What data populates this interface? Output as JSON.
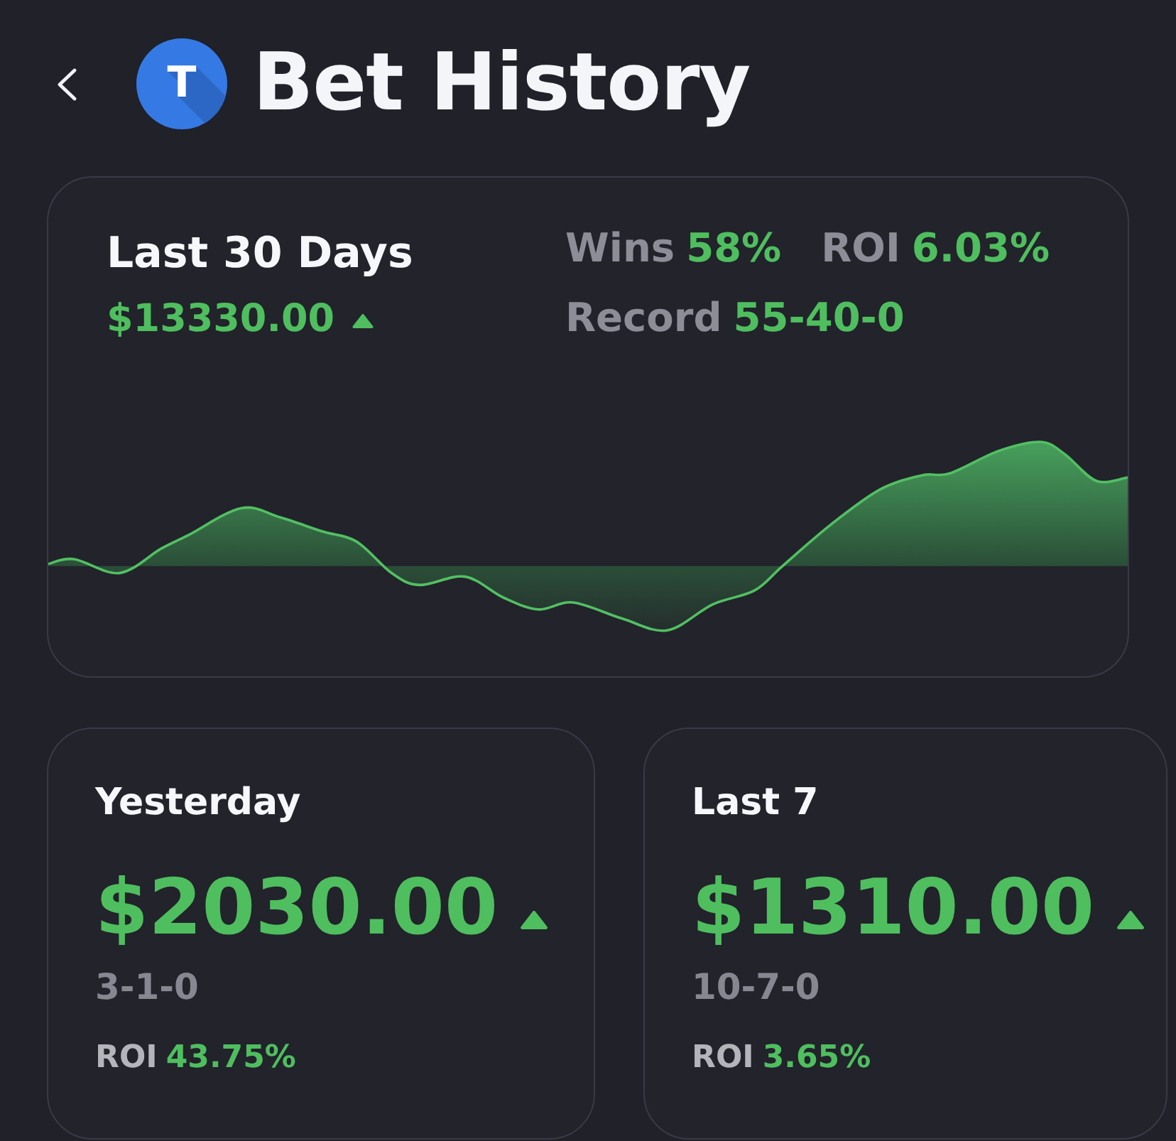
{
  "header": {
    "logo_letter": "T",
    "title": "Bet History"
  },
  "summary": {
    "title": "Last 30 Days",
    "amount": "$13330.00",
    "rising": true,
    "stat_rows": [
      [
        {
          "label": "Wins",
          "value": "58%"
        },
        {
          "label": "ROI",
          "value": "6.03%"
        }
      ],
      [
        {
          "label": "Record",
          "value": "55-40-0"
        }
      ]
    ]
  },
  "periods": [
    {
      "title": "Yesterday",
      "amount": "$2030.00",
      "rising": true,
      "record": "3-1-0",
      "roi_label": "ROI",
      "roi": "43.75%"
    },
    {
      "title": "Last 7",
      "amount": "$1310.00",
      "rising": true,
      "record": "10-7-0",
      "roi_label": "ROI",
      "roi": "3.65%"
    }
  ]
}
